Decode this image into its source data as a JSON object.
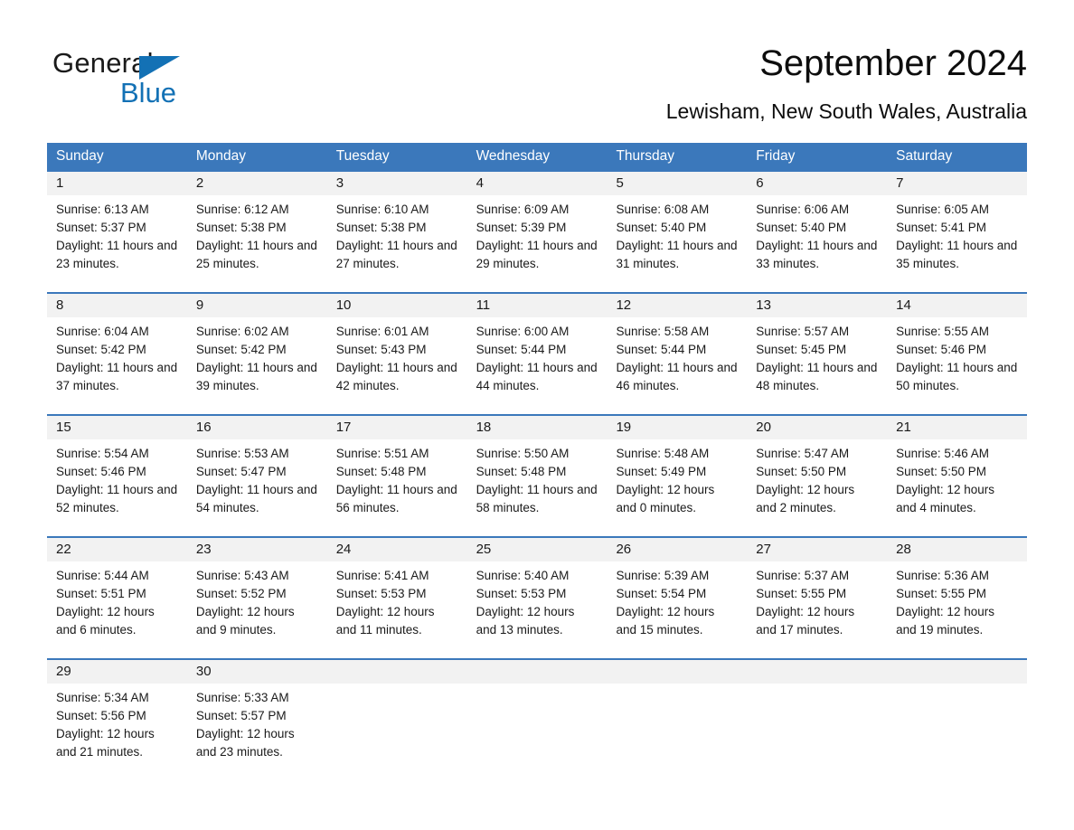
{
  "brand": {
    "name_part1": "General",
    "name_part2": "Blue",
    "accent_color": "#1371b5",
    "triangle_icon": "brand-triangle-icon"
  },
  "header": {
    "title": "September 2024",
    "subtitle": "Lewisham, New South Wales, Australia"
  },
  "theme": {
    "header_blue": "#3b78bb",
    "date_band_gray": "#f2f2f2",
    "text_color": "#1a1a1a"
  },
  "calendar": {
    "weekdays": [
      "Sunday",
      "Monday",
      "Tuesday",
      "Wednesday",
      "Thursday",
      "Friday",
      "Saturday"
    ],
    "weeks": [
      [
        {
          "date": "1",
          "sunrise": "Sunrise: 6:13 AM",
          "sunset": "Sunset: 5:37 PM",
          "daylight": "Daylight: 11 hours and 23 minutes."
        },
        {
          "date": "2",
          "sunrise": "Sunrise: 6:12 AM",
          "sunset": "Sunset: 5:38 PM",
          "daylight": "Daylight: 11 hours and 25 minutes."
        },
        {
          "date": "3",
          "sunrise": "Sunrise: 6:10 AM",
          "sunset": "Sunset: 5:38 PM",
          "daylight": "Daylight: 11 hours and 27 minutes."
        },
        {
          "date": "4",
          "sunrise": "Sunrise: 6:09 AM",
          "sunset": "Sunset: 5:39 PM",
          "daylight": "Daylight: 11 hours and 29 minutes."
        },
        {
          "date": "5",
          "sunrise": "Sunrise: 6:08 AM",
          "sunset": "Sunset: 5:40 PM",
          "daylight": "Daylight: 11 hours and 31 minutes."
        },
        {
          "date": "6",
          "sunrise": "Sunrise: 6:06 AM",
          "sunset": "Sunset: 5:40 PM",
          "daylight": "Daylight: 11 hours and 33 minutes."
        },
        {
          "date": "7",
          "sunrise": "Sunrise: 6:05 AM",
          "sunset": "Sunset: 5:41 PM",
          "daylight": "Daylight: 11 hours and 35 minutes."
        }
      ],
      [
        {
          "date": "8",
          "sunrise": "Sunrise: 6:04 AM",
          "sunset": "Sunset: 5:42 PM",
          "daylight": "Daylight: 11 hours and 37 minutes."
        },
        {
          "date": "9",
          "sunrise": "Sunrise: 6:02 AM",
          "sunset": "Sunset: 5:42 PM",
          "daylight": "Daylight: 11 hours and 39 minutes."
        },
        {
          "date": "10",
          "sunrise": "Sunrise: 6:01 AM",
          "sunset": "Sunset: 5:43 PM",
          "daylight": "Daylight: 11 hours and 42 minutes."
        },
        {
          "date": "11",
          "sunrise": "Sunrise: 6:00 AM",
          "sunset": "Sunset: 5:44 PM",
          "daylight": "Daylight: 11 hours and 44 minutes."
        },
        {
          "date": "12",
          "sunrise": "Sunrise: 5:58 AM",
          "sunset": "Sunset: 5:44 PM",
          "daylight": "Daylight: 11 hours and 46 minutes."
        },
        {
          "date": "13",
          "sunrise": "Sunrise: 5:57 AM",
          "sunset": "Sunset: 5:45 PM",
          "daylight": "Daylight: 11 hours and 48 minutes."
        },
        {
          "date": "14",
          "sunrise": "Sunrise: 5:55 AM",
          "sunset": "Sunset: 5:46 PM",
          "daylight": "Daylight: 11 hours and 50 minutes."
        }
      ],
      [
        {
          "date": "15",
          "sunrise": "Sunrise: 5:54 AM",
          "sunset": "Sunset: 5:46 PM",
          "daylight": "Daylight: 11 hours and 52 minutes."
        },
        {
          "date": "16",
          "sunrise": "Sunrise: 5:53 AM",
          "sunset": "Sunset: 5:47 PM",
          "daylight": "Daylight: 11 hours and 54 minutes."
        },
        {
          "date": "17",
          "sunrise": "Sunrise: 5:51 AM",
          "sunset": "Sunset: 5:48 PM",
          "daylight": "Daylight: 11 hours and 56 minutes."
        },
        {
          "date": "18",
          "sunrise": "Sunrise: 5:50 AM",
          "sunset": "Sunset: 5:48 PM",
          "daylight": "Daylight: 11 hours and 58 minutes."
        },
        {
          "date": "19",
          "sunrise": "Sunrise: 5:48 AM",
          "sunset": "Sunset: 5:49 PM",
          "daylight": "Daylight: 12 hours and 0 minutes."
        },
        {
          "date": "20",
          "sunrise": "Sunrise: 5:47 AM",
          "sunset": "Sunset: 5:50 PM",
          "daylight": "Daylight: 12 hours and 2 minutes."
        },
        {
          "date": "21",
          "sunrise": "Sunrise: 5:46 AM",
          "sunset": "Sunset: 5:50 PM",
          "daylight": "Daylight: 12 hours and 4 minutes."
        }
      ],
      [
        {
          "date": "22",
          "sunrise": "Sunrise: 5:44 AM",
          "sunset": "Sunset: 5:51 PM",
          "daylight": "Daylight: 12 hours and 6 minutes."
        },
        {
          "date": "23",
          "sunrise": "Sunrise: 5:43 AM",
          "sunset": "Sunset: 5:52 PM",
          "daylight": "Daylight: 12 hours and 9 minutes."
        },
        {
          "date": "24",
          "sunrise": "Sunrise: 5:41 AM",
          "sunset": "Sunset: 5:53 PM",
          "daylight": "Daylight: 12 hours and 11 minutes."
        },
        {
          "date": "25",
          "sunrise": "Sunrise: 5:40 AM",
          "sunset": "Sunset: 5:53 PM",
          "daylight": "Daylight: 12 hours and 13 minutes."
        },
        {
          "date": "26",
          "sunrise": "Sunrise: 5:39 AM",
          "sunset": "Sunset: 5:54 PM",
          "daylight": "Daylight: 12 hours and 15 minutes."
        },
        {
          "date": "27",
          "sunrise": "Sunrise: 5:37 AM",
          "sunset": "Sunset: 5:55 PM",
          "daylight": "Daylight: 12 hours and 17 minutes."
        },
        {
          "date": "28",
          "sunrise": "Sunrise: 5:36 AM",
          "sunset": "Sunset: 5:55 PM",
          "daylight": "Daylight: 12 hours and 19 minutes."
        }
      ],
      [
        {
          "date": "29",
          "sunrise": "Sunrise: 5:34 AM",
          "sunset": "Sunset: 5:56 PM",
          "daylight": "Daylight: 12 hours and 21 minutes."
        },
        {
          "date": "30",
          "sunrise": "Sunrise: 5:33 AM",
          "sunset": "Sunset: 5:57 PM",
          "daylight": "Daylight: 12 hours and 23 minutes."
        },
        {
          "date": "",
          "sunrise": "",
          "sunset": "",
          "daylight": ""
        },
        {
          "date": "",
          "sunrise": "",
          "sunset": "",
          "daylight": ""
        },
        {
          "date": "",
          "sunrise": "",
          "sunset": "",
          "daylight": ""
        },
        {
          "date": "",
          "sunrise": "",
          "sunset": "",
          "daylight": ""
        },
        {
          "date": "",
          "sunrise": "",
          "sunset": "",
          "daylight": ""
        }
      ]
    ]
  }
}
